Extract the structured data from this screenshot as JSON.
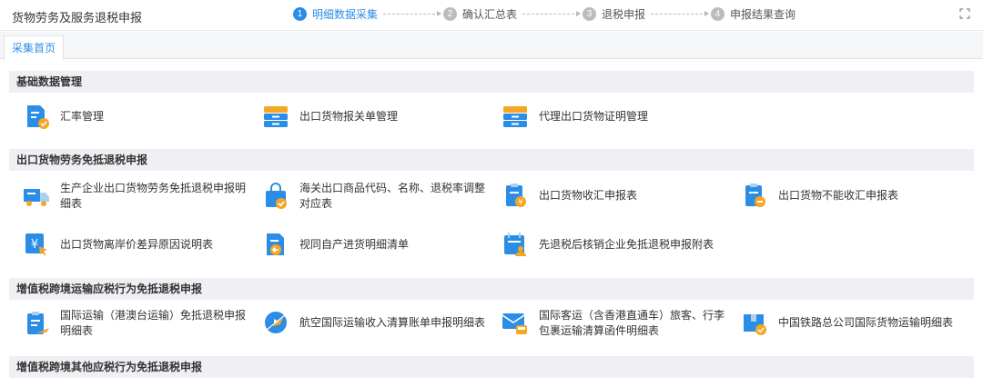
{
  "header": {
    "title": "货物劳务及服务退税申报",
    "steps": [
      {
        "num": "1",
        "label": "明细数据采集"
      },
      {
        "num": "2",
        "label": "确认汇总表"
      },
      {
        "num": "3",
        "label": "退税申报"
      },
      {
        "num": "4",
        "label": "申报结果查询"
      }
    ],
    "expand_icon": "fullscreen-icon"
  },
  "tabs": [
    {
      "label": "采集首页"
    }
  ],
  "sections": [
    {
      "title": "基础数据管理",
      "items": [
        {
          "label": "汇率管理",
          "icon": "document-check-icon"
        },
        {
          "label": "出口货物报关单管理",
          "icon": "cabinet-icon"
        },
        {
          "label": "代理出口货物证明管理",
          "icon": "cabinet-icon"
        }
      ]
    },
    {
      "title": "出口货物劳务免抵退税申报",
      "items": [
        {
          "label": "生产企业出口货物劳务免抵退税申报明细表",
          "icon": "truck-icon"
        },
        {
          "label": "海关出口商品代码、名称、退税率调整对应表",
          "icon": "shopping-bag-icon"
        },
        {
          "label": "出口货物收汇申报表",
          "icon": "clipboard-coin-icon"
        },
        {
          "label": "出口货物不能收汇申报表",
          "icon": "clipboard-minus-icon"
        },
        {
          "label": "出口货物离岸价差异原因说明表",
          "icon": "yen-cursor-icon"
        },
        {
          "label": "视同自产进货明细清单",
          "icon": "import-arrow-icon"
        },
        {
          "label": "先退税后核销企业免抵退税申报附表",
          "icon": "calendar-user-icon"
        }
      ]
    },
    {
      "title": "增值税跨境运输应税行为免抵退税申报",
      "items": [
        {
          "label": "国际运输（港澳台运输）免抵退税申报明细表",
          "icon": "clipboard-plane-icon"
        },
        {
          "label": "航空国际运输收入清算账单申报明细表",
          "icon": "airplane-globe-icon"
        },
        {
          "label": "国际客运（含香港直通车）旅客、行李包裹运输清算函件明细表",
          "icon": "mail-bus-icon"
        },
        {
          "label": "中国铁路总公司国际货物运输明细表",
          "icon": "package-check-icon"
        }
      ]
    },
    {
      "title": "增值税跨境其他应税行为免抵退税申报",
      "items": []
    }
  ],
  "colors": {
    "blue": "#2c8de6",
    "orange": "#f6a623",
    "light_blue": "#a8d1f4"
  }
}
